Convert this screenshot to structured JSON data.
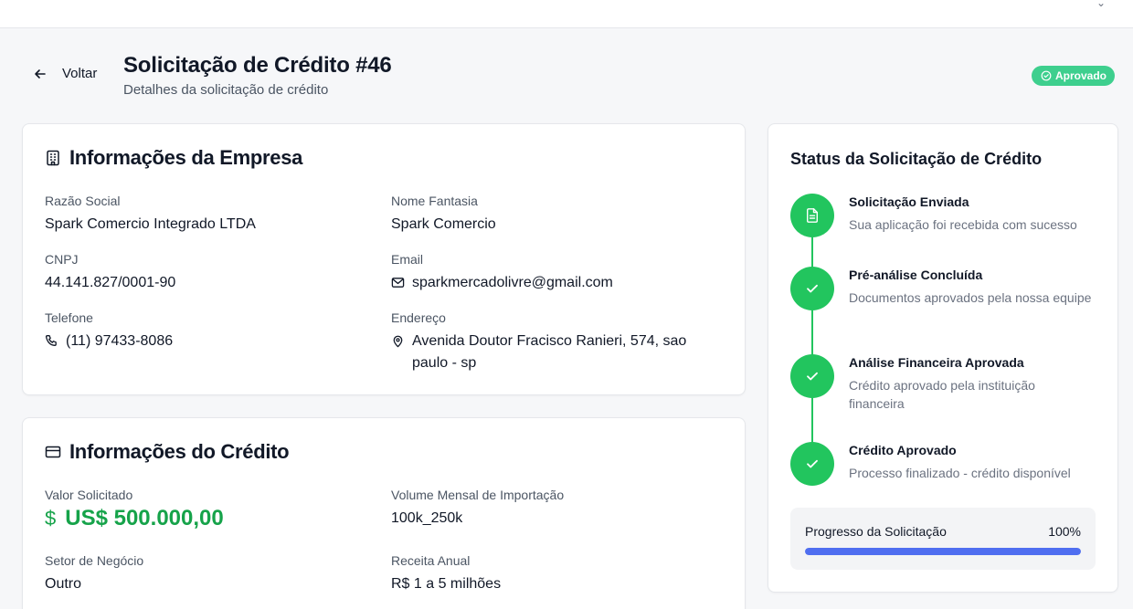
{
  "header": {
    "back_label": "Voltar",
    "title": "Solicitação de Crédito #46",
    "subtitle": "Detalhes da solicitação de crédito",
    "status_badge": "Aprovado"
  },
  "company": {
    "heading": "Informações da Empresa",
    "fields": {
      "razao_social": {
        "label": "Razão Social",
        "value": "Spark Comercio Integrado LTDA"
      },
      "nome_fantasia": {
        "label": "Nome Fantasia",
        "value": "Spark Comercio"
      },
      "cnpj": {
        "label": "CNPJ",
        "value": "44.141.827/0001-90"
      },
      "email": {
        "label": "Email",
        "value": "sparkmercadolivre@gmail.com"
      },
      "telefone": {
        "label": "Telefone",
        "value": "(11) 97433-8086"
      },
      "endereco": {
        "label": "Endereço",
        "value": "Avenida Doutor Fracisco Ranieri, 574, sao paulo - sp"
      }
    }
  },
  "credit": {
    "heading": "Informações do Crédito",
    "fields": {
      "valor_solicitado": {
        "label": "Valor Solicitado",
        "value": "US$ 500.000,00"
      },
      "volume_mensal": {
        "label": "Volume Mensal de Importação",
        "value": "100k_250k"
      },
      "setor": {
        "label": "Setor de Negócio",
        "value": "Outro"
      },
      "receita": {
        "label": "Receita Anual",
        "value": "R$ 1 a 5 milhões"
      }
    }
  },
  "status_panel": {
    "heading": "Status da Solicitação de Crédito",
    "steps": [
      {
        "title": "Solicitação Enviada",
        "desc": "Sua aplicação foi recebida com sucesso",
        "icon": "document-icon"
      },
      {
        "title": "Pré-análise Concluída",
        "desc": "Documentos aprovados pela nossa equipe",
        "icon": "check-icon"
      },
      {
        "title": "Análise Financeira Aprovada",
        "desc": "Crédito aprovado pela instituição financeira",
        "icon": "check-icon"
      },
      {
        "title": "Crédito Aprovado",
        "desc": "Processo finalizado - crédito disponível",
        "icon": "check-icon"
      }
    ],
    "progress": {
      "label": "Progresso da Solicitação",
      "value_text": "100%",
      "fraction": 1.0
    }
  },
  "colors": {
    "success": "#22c55e",
    "badge": "#3ecf8e",
    "amount": "#16a34a",
    "progress": "#4f6ef0"
  }
}
